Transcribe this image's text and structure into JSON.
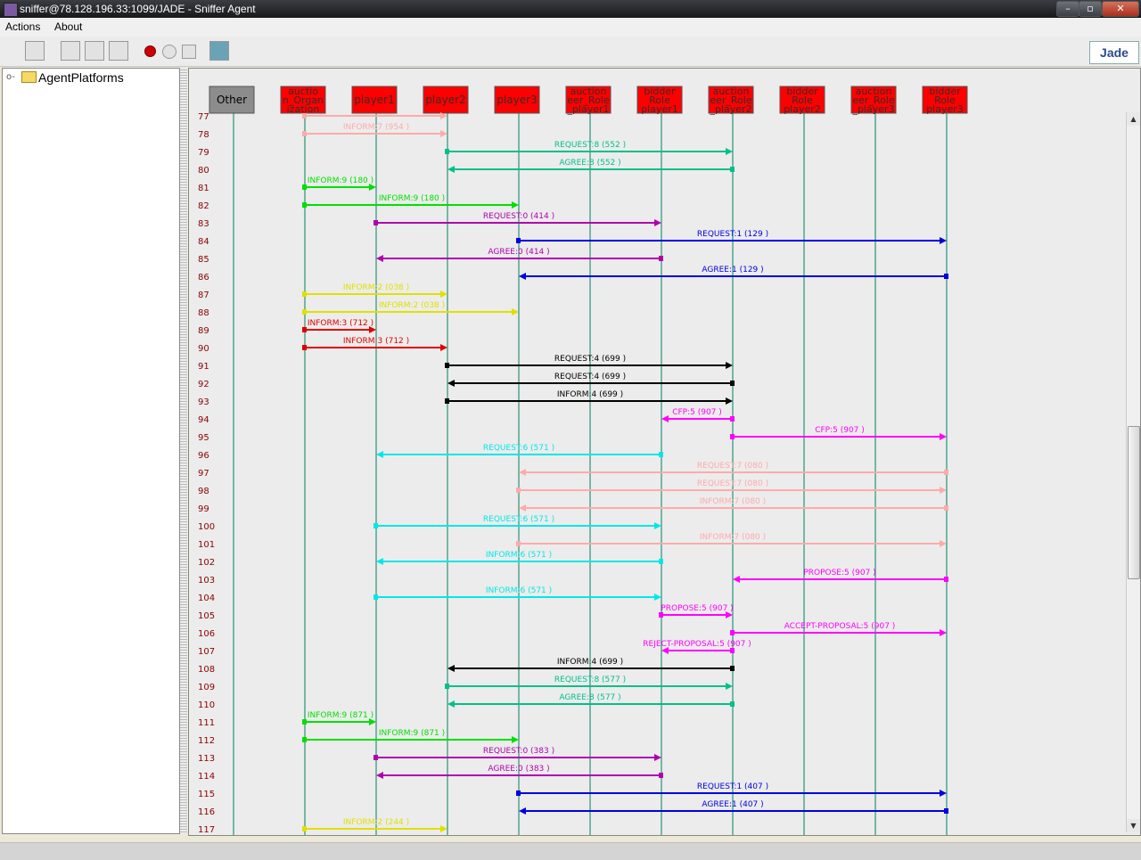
{
  "window": {
    "title": "sniffer@78.128.196.33:1099/JADE - Sniffer Agent",
    "min": "–",
    "max": "▫",
    "close": "✕"
  },
  "menu": {
    "actions": "Actions",
    "about": "About"
  },
  "toolbar": {
    "logo": "Jade"
  },
  "tree": {
    "root": "AgentPlatforms"
  },
  "agents": [
    {
      "label": "Other",
      "color": "#8c8c8c"
    },
    {
      "label": "auctio\nn_Organ\nization",
      "color": "#ff0000"
    },
    {
      "label": "player1",
      "color": "#ff0000"
    },
    {
      "label": "player2",
      "color": "#ff0000"
    },
    {
      "label": "player3",
      "color": "#ff0000"
    },
    {
      "label": "auction\neer_Role\n_player1",
      "color": "#ff0000"
    },
    {
      "label": "bidder\nRole\nplayer1",
      "color": "#ff0000"
    },
    {
      "label": "auction\neer_Role\n_player2",
      "color": "#ff0000"
    },
    {
      "label": "bidder\nRole\nplayer2",
      "color": "#ff0000"
    },
    {
      "label": "auction\neer_Role\n_player3",
      "color": "#ff0000"
    },
    {
      "label": "bidder\nRole\nplayer3",
      "color": "#ff0000"
    }
  ],
  "messages": [
    {
      "row": "77",
      "from": 1,
      "to": 3,
      "label": "",
      "color": "#ffaaaa"
    },
    {
      "row": "78",
      "from": 1,
      "to": 3,
      "label": "INFORM:7 (954      )",
      "color": "#ffaaaa"
    },
    {
      "row": "79",
      "from": 3,
      "to": 7,
      "label": "REQUEST:8 (552      )",
      "color": "#00c08a"
    },
    {
      "row": "80",
      "from": 7,
      "to": 3,
      "label": "AGREE:8 (552      )",
      "color": "#00c08a"
    },
    {
      "row": "81",
      "from": 1,
      "to": 2,
      "label": "INFORM:9 (180      )",
      "color": "#00e000"
    },
    {
      "row": "82",
      "from": 1,
      "to": 4,
      "label": "INFORM:9 (180      )",
      "color": "#00e000"
    },
    {
      "row": "83",
      "from": 2,
      "to": 6,
      "label": "REQUEST:0 (414      )",
      "color": "#b000b0"
    },
    {
      "row": "84",
      "from": 4,
      "to": 10,
      "label": "REQUEST:1 (129      )",
      "color": "#0000e0"
    },
    {
      "row": "85",
      "from": 6,
      "to": 2,
      "label": "AGREE:0 (414      )",
      "color": "#b000b0"
    },
    {
      "row": "86",
      "from": 10,
      "to": 4,
      "label": "AGREE:1 (129      )",
      "color": "#0000e0"
    },
    {
      "row": "87",
      "from": 1,
      "to": 3,
      "label": "INFORM:2 (038      )",
      "color": "#e0e000"
    },
    {
      "row": "88",
      "from": 1,
      "to": 4,
      "label": "INFORM:2 (038      )",
      "color": "#e0e000"
    },
    {
      "row": "89",
      "from": 1,
      "to": 2,
      "label": "INFORM:3 (712      )",
      "color": "#e00000"
    },
    {
      "row": "90",
      "from": 1,
      "to": 3,
      "label": "INFORM:3 (712      )",
      "color": "#e00000"
    },
    {
      "row": "91",
      "from": 3,
      "to": 7,
      "label": "REQUEST:4 (699      )",
      "color": "#000000"
    },
    {
      "row": "92",
      "from": 7,
      "to": 3,
      "label": "REQUEST:4 (699      )",
      "color": "#000000"
    },
    {
      "row": "93",
      "from": 3,
      "to": 7,
      "label": "INFORM:4 (699      )",
      "color": "#000000"
    },
    {
      "row": "94",
      "from": 7,
      "to": 6,
      "label": "CFP:5 (907      )",
      "color": "#ff00ff"
    },
    {
      "row": "95",
      "from": 7,
      "to": 10,
      "label": "CFP:5 (907      )",
      "color": "#ff00ff"
    },
    {
      "row": "96",
      "from": 6,
      "to": 2,
      "label": "REQUEST:6 (571      )",
      "color": "#00e8e8"
    },
    {
      "row": "97",
      "from": 10,
      "to": 4,
      "label": "REQUEST:7 (080      )",
      "color": "#ffaaaa"
    },
    {
      "row": "98",
      "from": 4,
      "to": 10,
      "label": "REQUEST:7 (080      )",
      "color": "#ffaaaa"
    },
    {
      "row": "99",
      "from": 10,
      "to": 4,
      "label": "INFORM:7 (080      )",
      "color": "#ffaaaa"
    },
    {
      "row": "100",
      "from": 2,
      "to": 6,
      "label": "REQUEST:6 (571      )",
      "color": "#00e8e8"
    },
    {
      "row": "101",
      "from": 4,
      "to": 10,
      "label": "INFORM:7 (080      )",
      "color": "#ffaaaa"
    },
    {
      "row": "102",
      "from": 6,
      "to": 2,
      "label": "INFORM:6 (571      )",
      "color": "#00e8e8"
    },
    {
      "row": "103",
      "from": 10,
      "to": 7,
      "label": "PROPOSE:5 (907      )",
      "color": "#ff00ff"
    },
    {
      "row": "104",
      "from": 2,
      "to": 6,
      "label": "INFORM:6 (571      )",
      "color": "#00e8e8"
    },
    {
      "row": "105",
      "from": 6,
      "to": 7,
      "label": "PROPOSE:5 (907      )",
      "color": "#ff00ff"
    },
    {
      "row": "106",
      "from": 7,
      "to": 10,
      "label": "ACCEPT-PROPOSAL:5 (907      )",
      "color": "#ff00ff"
    },
    {
      "row": "107",
      "from": 7,
      "to": 6,
      "label": "REJECT-PROPOSAL:5 (907      )",
      "color": "#ff00ff"
    },
    {
      "row": "108",
      "from": 7,
      "to": 3,
      "label": "INFORM:4 (699      )",
      "color": "#000000"
    },
    {
      "row": "109",
      "from": 3,
      "to": 7,
      "label": "REQUEST:8 (577      )",
      "color": "#00c08a"
    },
    {
      "row": "110",
      "from": 7,
      "to": 3,
      "label": "AGREE:8 (577      )",
      "color": "#00c08a"
    },
    {
      "row": "111",
      "from": 1,
      "to": 2,
      "label": "INFORM:9 (871      )",
      "color": "#00e000"
    },
    {
      "row": "112",
      "from": 1,
      "to": 4,
      "label": "INFORM:9 (871      )",
      "color": "#00e000"
    },
    {
      "row": "113",
      "from": 2,
      "to": 6,
      "label": "REQUEST:0 (383      )",
      "color": "#b000b0"
    },
    {
      "row": "114",
      "from": 6,
      "to": 2,
      "label": "AGREE:0 (383      )",
      "color": "#b000b0"
    },
    {
      "row": "115",
      "from": 4,
      "to": 10,
      "label": "REQUEST:1 (407      )",
      "color": "#0000e0"
    },
    {
      "row": "116",
      "from": 10,
      "to": 4,
      "label": "AGREE:1 (407      )",
      "color": "#0000e0"
    },
    {
      "row": "117",
      "from": 1,
      "to": 3,
      "label": "INFORM:2 (244      )",
      "color": "#e0e000"
    }
  ],
  "colors": {
    "lifeline": "#008060",
    "row_number": "#8b0000"
  }
}
